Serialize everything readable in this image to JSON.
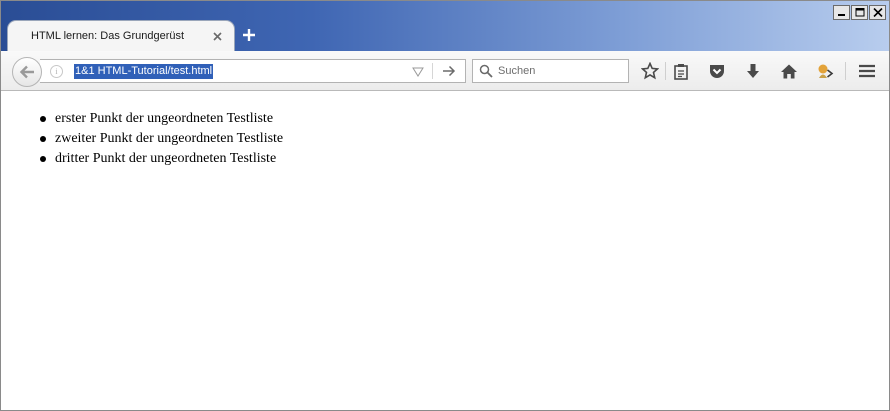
{
  "window": {
    "controls": [
      "minimize",
      "maximize",
      "close"
    ]
  },
  "tab": {
    "title": "HTML lernen: Das Grundgerüst",
    "close_icon": "close-icon",
    "new_tab_icon": "plus-icon"
  },
  "navbar": {
    "url": "1&1 HTML-Tutorial/test.html",
    "search_placeholder": "Suchen",
    "icons": [
      "back-arrow-icon",
      "info-icon",
      "dropdown-arrow-icon",
      "go-arrow-icon",
      "search-icon",
      "bookmark-star-icon",
      "reading-list-icon",
      "pocket-icon",
      "download-icon",
      "home-icon",
      "profile-icon",
      "menu-icon"
    ]
  },
  "page": {
    "list_items": [
      "erster Punkt der ungeordneten Testliste",
      "zweiter Punkt der ungeordneten Testliste",
      "dritter Punkt der ungeordneten Testliste"
    ]
  },
  "colors": {
    "titlebar_dark": "#2a4d95",
    "titlebar_light": "#b8cdee",
    "url_selection": "#3060b8"
  }
}
